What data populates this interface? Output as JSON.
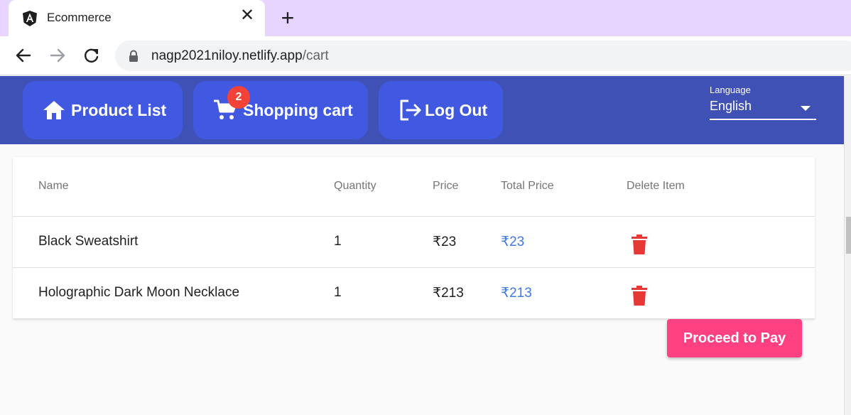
{
  "browser": {
    "tab_title": "Ecommerce",
    "favicon": "angular-logo-icon",
    "url_host": "nagp2021niloy.netlify.app",
    "url_path": "/cart"
  },
  "header": {
    "product_list_label": "Product List",
    "shopping_cart_label": "Shopping cart",
    "cart_count": "2",
    "logout_label": "Log Out",
    "language_label": "Language",
    "language_value": "English"
  },
  "cart_table": {
    "columns": [
      "Name",
      "Quantity",
      "Price",
      "Total Price",
      "Delete Item"
    ],
    "rows": [
      {
        "name": "Black Sweatshirt",
        "quantity": "1",
        "price": "₹23",
        "total": "₹23"
      },
      {
        "name": "Holographic Dark Moon Necklace",
        "quantity": "1",
        "price": "₹213",
        "total": "₹213"
      }
    ]
  },
  "actions": {
    "pay_label": "Proceed to Pay"
  },
  "colors": {
    "tabbar": "#e8d5ff",
    "header": "#3f51b5",
    "header_button": "#4059e0",
    "badge": "#f44336",
    "total_price": "#3f7ae0",
    "delete": "#e53935",
    "pay_button": "#ff4081"
  }
}
